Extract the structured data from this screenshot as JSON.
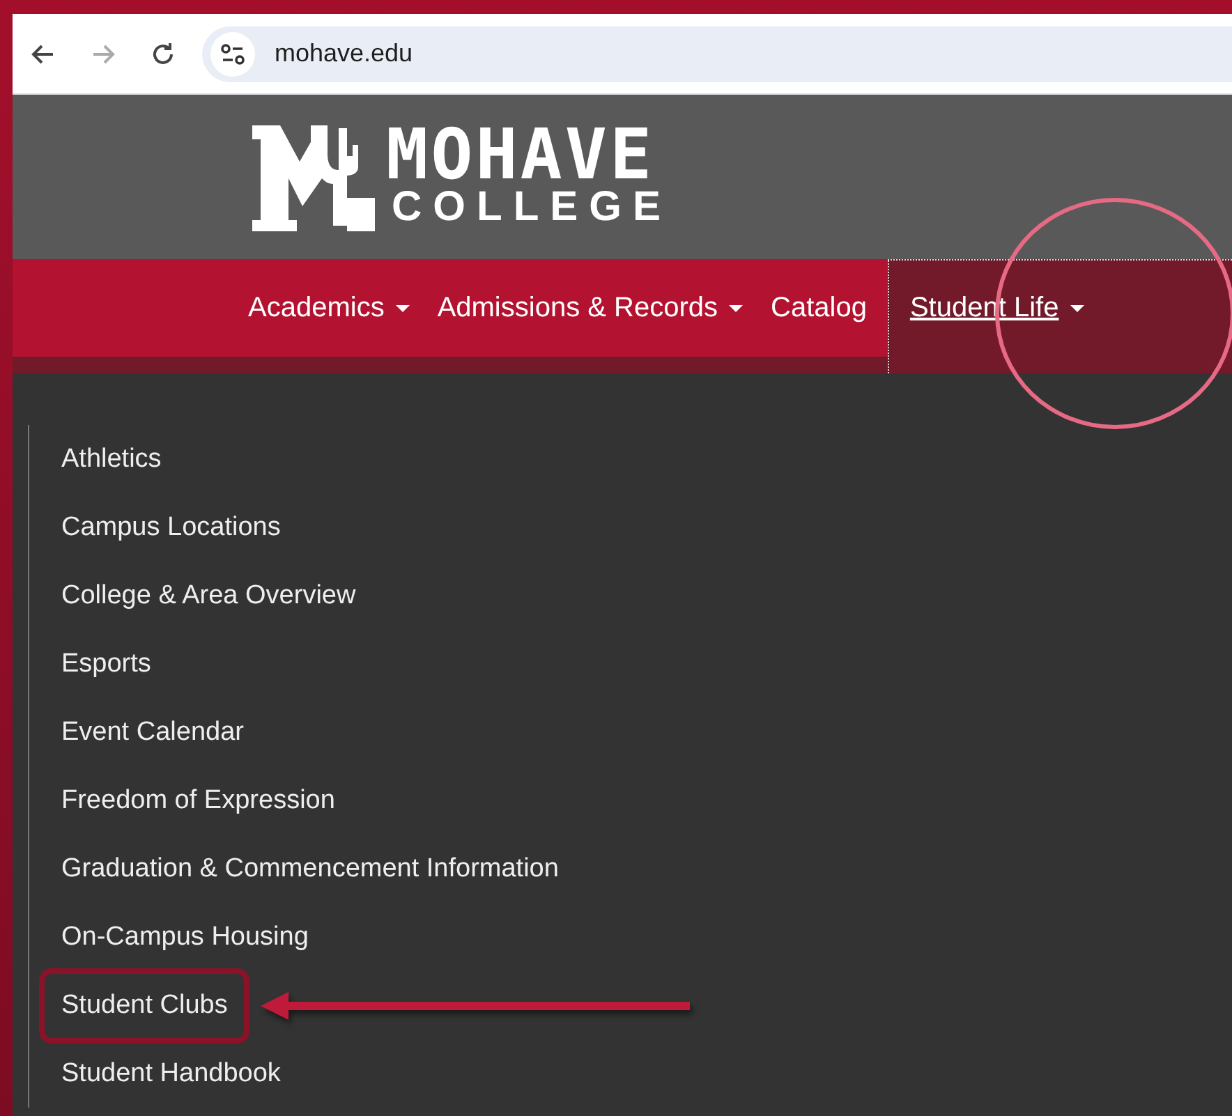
{
  "browser": {
    "url": "mohave.edu"
  },
  "logo": {
    "line_1": "MOHAVE",
    "line_2": "COLLEGE"
  },
  "nav": [
    {
      "label": "Academics",
      "has_caret": true,
      "selected": false,
      "circled": false
    },
    {
      "label": "Admissions & Records",
      "has_caret": true,
      "selected": false,
      "circled": false
    },
    {
      "label": "Catalog",
      "has_caret": false,
      "selected": false,
      "circled": false
    },
    {
      "label": "Student Life",
      "has_caret": true,
      "selected": true,
      "circled": true
    }
  ],
  "dropdown": [
    {
      "label": "Athletics",
      "highlighted": false
    },
    {
      "label": "Campus Locations",
      "highlighted": false
    },
    {
      "label": "College & Area Overview",
      "highlighted": false
    },
    {
      "label": "Esports",
      "highlighted": false
    },
    {
      "label": "Event Calendar",
      "highlighted": false
    },
    {
      "label": "Freedom of Expression",
      "highlighted": false
    },
    {
      "label": "Graduation & Commencement Information",
      "highlighted": false
    },
    {
      "label": "On-Campus Housing",
      "highlighted": false
    },
    {
      "label": "Student Clubs",
      "highlighted": true
    },
    {
      "label": "Student Handbook",
      "highlighted": false
    }
  ]
}
